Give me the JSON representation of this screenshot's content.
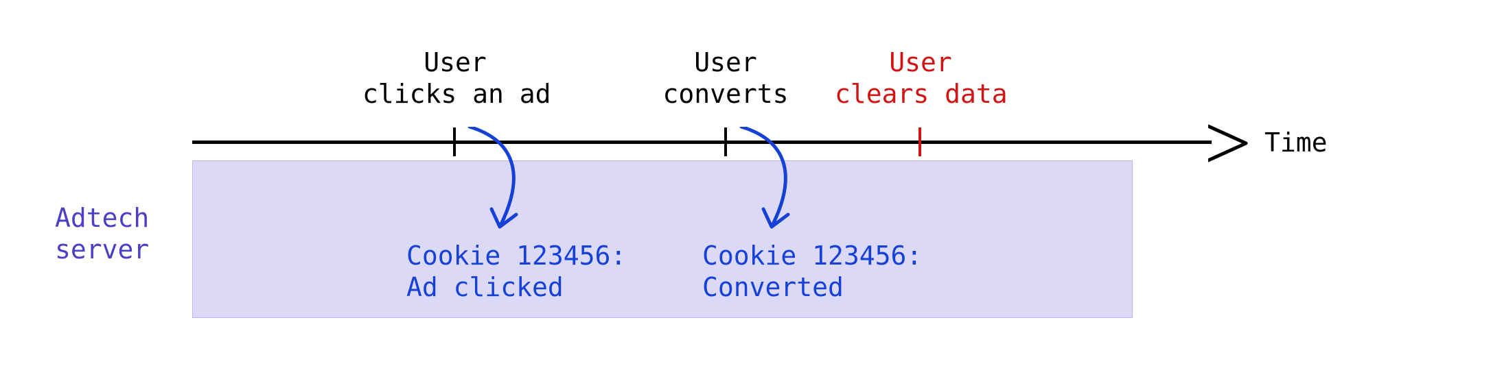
{
  "axis_label": "Time",
  "server_label": "Adtech\nserver",
  "events": {
    "click": {
      "label": "User\nclicks an ad",
      "color": "black"
    },
    "convert": {
      "label": "User\nconverts",
      "color": "black"
    },
    "clear": {
      "label": "User\nclears data",
      "color": "red"
    }
  },
  "records": {
    "click": "Cookie 123456:\nAd clicked",
    "convert": "Cookie 123456:\nConverted"
  }
}
